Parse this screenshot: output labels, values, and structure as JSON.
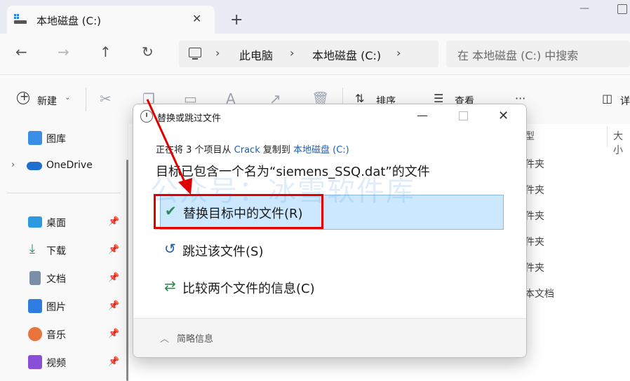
{
  "tab": {
    "title": "本地磁盘 (C:)",
    "close": "✕"
  },
  "new_tab": "+",
  "address": {
    "crumbs": [
      "此电脑",
      "本地磁盘 (C:)"
    ]
  },
  "search": {
    "placeholder": "在 本地磁盘 (C:) 中搜索"
  },
  "toolbar": {
    "new_label": "新建",
    "sort_label": "排序",
    "view_label": "查看",
    "more": "···",
    "details_label": "详"
  },
  "sidebar": {
    "items": [
      {
        "label": "图库"
      },
      {
        "label": "OneDrive"
      },
      {
        "label": "桌面"
      },
      {
        "label": "下载"
      },
      {
        "label": "文档"
      },
      {
        "label": "图片"
      },
      {
        "label": "音乐"
      },
      {
        "label": "视频"
      }
    ]
  },
  "columns": {
    "type_fragment": "型",
    "size": "大小"
  },
  "file_types": [
    "件夹",
    "件夹",
    "件夹",
    "件夹",
    "件夹",
    "本文档"
  ],
  "dialog": {
    "title": "替换或跳过文件",
    "progress_prefix": "正在将 3 个项目从 ",
    "source": "Crack",
    "progress_mid": " 复制到 ",
    "destination": "本地磁盘 (C:)",
    "dest_message": "目标已包含一个名为“siemens_SSQ.dat”的文件",
    "options": [
      {
        "label": "替换目标中的文件(R)"
      },
      {
        "label": "跳过该文件(S)"
      },
      {
        "label": "比较两个文件的信息(C)"
      }
    ],
    "details_label": "简略信息"
  },
  "watermark": "公众号：冰雪软件库",
  "colors": {
    "accent": "#1a5fb4",
    "selection": "#cce8ff",
    "highlight": "#e00000",
    "check": "#2e8b57"
  }
}
